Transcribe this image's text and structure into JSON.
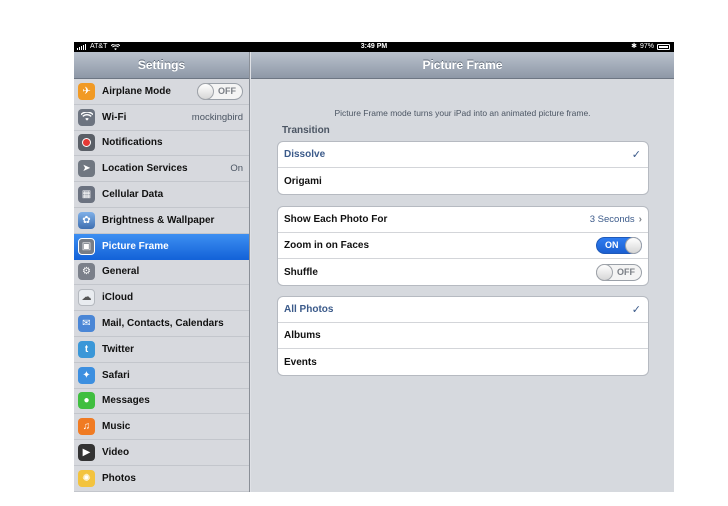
{
  "status_bar": {
    "carrier": "AT&T",
    "time": "3:49 PM",
    "battery": "97%"
  },
  "sidebar": {
    "title": "Settings",
    "items": [
      {
        "label": "Airplane Mode",
        "icon": "airplane-icon",
        "color": "#f19a25",
        "toggle": "OFF"
      },
      {
        "label": "Wi-Fi",
        "icon": "wifi-icon",
        "color": "#6d7480",
        "value": "mockingbird"
      },
      {
        "label": "Notifications",
        "icon": "notifications-icon",
        "color": "#d62f2f"
      },
      {
        "label": "Location Services",
        "icon": "location-icon",
        "color": "#707781",
        "value": "On"
      },
      {
        "label": "Cellular Data",
        "icon": "cellular-icon",
        "color": "#6b7280"
      },
      {
        "label": "Brightness & Wallpaper",
        "icon": "brightness-icon",
        "color": "#5e8ec9"
      },
      {
        "label": "Picture Frame",
        "icon": "picture-frame-icon",
        "color": "#777d86",
        "selected": true
      },
      {
        "label": "General",
        "icon": "gear-icon",
        "color": "#7b808a"
      },
      {
        "label": "iCloud",
        "icon": "cloud-icon",
        "color": "#e9ecf0"
      },
      {
        "label": "Mail, Contacts, Calendars",
        "icon": "mail-icon",
        "color": "#4a86d6"
      },
      {
        "label": "Twitter",
        "icon": "twitter-icon",
        "color": "#3a97d8"
      },
      {
        "label": "Safari",
        "icon": "safari-icon",
        "color": "#3c8fe0"
      },
      {
        "label": "Messages",
        "icon": "messages-icon",
        "color": "#3fbe3f"
      },
      {
        "label": "Music",
        "icon": "music-icon",
        "color": "#f07b23"
      },
      {
        "label": "Video",
        "icon": "video-icon",
        "color": "#333333"
      },
      {
        "label": "Photos",
        "icon": "photos-icon",
        "color": "#f3c33e"
      }
    ]
  },
  "detail": {
    "title": "Picture Frame",
    "description": "Picture Frame mode turns your iPad into an animated picture frame.",
    "transition_title": "Transition",
    "transition_options": [
      {
        "label": "Dissolve",
        "checked": true
      },
      {
        "label": "Origami",
        "checked": false
      }
    ],
    "settings": [
      {
        "label": "Show Each Photo For",
        "value": "3 Seconds"
      },
      {
        "label": "Zoom in on Faces",
        "toggle": "ON"
      },
      {
        "label": "Shuffle",
        "toggle": "OFF"
      }
    ],
    "photo_source": [
      {
        "label": "All Photos",
        "checked": true
      },
      {
        "label": "Albums",
        "checked": false
      },
      {
        "label": "Events",
        "checked": false
      }
    ]
  }
}
